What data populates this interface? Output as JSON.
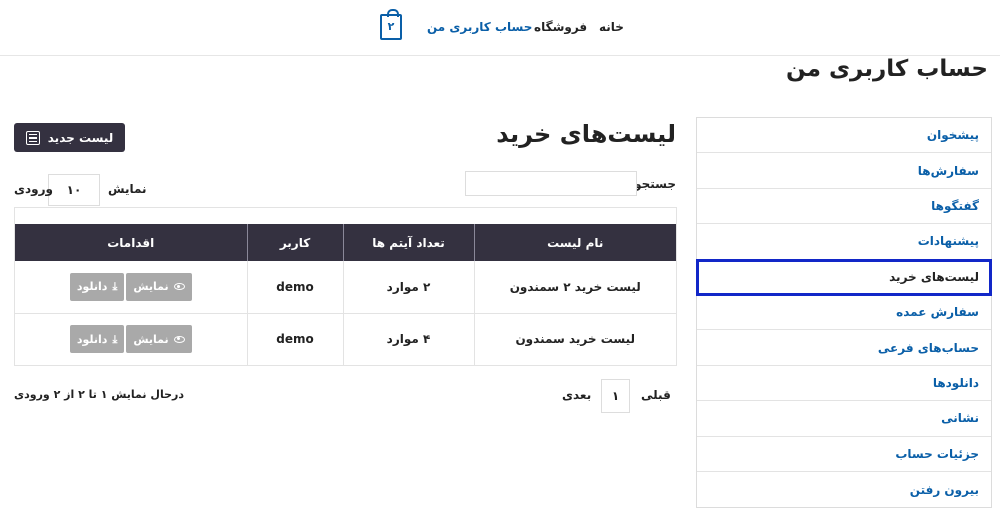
{
  "nav": {
    "home": "خانه",
    "shop": "فروشگاه",
    "my_account": "حساب کاربری من",
    "cart_count": "۲"
  },
  "page_title": "حساب کاربری من",
  "sidebar": {
    "items": [
      {
        "label": "پیشخوان"
      },
      {
        "label": "سفارش‌ها"
      },
      {
        "label": "گفتگوها"
      },
      {
        "label": "پیشنهادات"
      },
      {
        "label": "لیست‌های خرید"
      },
      {
        "label": "سفارش عمده"
      },
      {
        "label": "حساب‌های فرعی"
      },
      {
        "label": "دانلودها"
      },
      {
        "label": "نشانی"
      },
      {
        "label": "جزئیات حساب"
      },
      {
        "label": "بیرون رفتن"
      }
    ],
    "active_index": 4
  },
  "main": {
    "title": "لیست‌های خرید",
    "new_list_button": "لیست جدید",
    "search_label": "جستجو:",
    "search_value": "",
    "show_label": "نمایش",
    "per_page": "۱۰",
    "entries_label": "ورودی"
  },
  "table": {
    "headers": [
      "نام لیست",
      "تعداد آیتم ها",
      "کاربر",
      "اقدامات"
    ],
    "rows": [
      {
        "name": "لیست خرید ۲ سمندون",
        "count": "۲ موارد",
        "user": "demo",
        "view": "نمایش",
        "download": "دانلود"
      },
      {
        "name": "لیست خرید سمندون",
        "count": "۴ موارد",
        "user": "demo",
        "view": "نمایش",
        "download": "دانلود"
      }
    ]
  },
  "pagination": {
    "info": "درحال نمایش ۱ تا ۲ از ۲ ورودی",
    "prev": "قبلی",
    "page": "۱",
    "next": "بعدی"
  },
  "colors": {
    "accent": "#0a5fa8",
    "dark": "#343140",
    "active_outline": "#1227c8",
    "button_gray": "#a9a9a9"
  }
}
